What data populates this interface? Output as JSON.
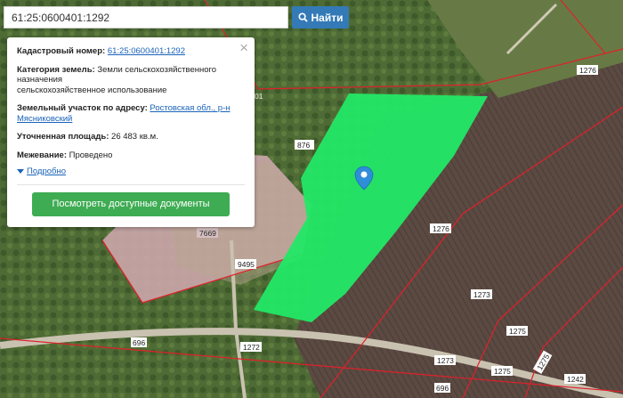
{
  "search": {
    "value": "61:25:0600401:1292",
    "button_label": "Найти"
  },
  "card": {
    "cadastral_label": "Кадастровый номер:",
    "cadastral_value": "61:25:0600401:1292",
    "category_label": "Категория земель:",
    "category_value": "Земли сельскохозяйственного назначения",
    "category_value2": "сельскохозяйственное использование",
    "address_label": "Земельный участок по адресу:",
    "address_value": "Ростовская обл., р-н Мясниковский",
    "area_label": "Уточненная площадь:",
    "area_value": "26 483 кв.м.",
    "survey_label": "Межевание:",
    "survey_value": "Проведено",
    "more_label": "Подробно",
    "docs_button": "Посмотреть доступные документы",
    "close_symbol": "×"
  },
  "map": {
    "parcel_labels": [
      "876",
      "1276",
      "1276",
      "7669",
      "9495",
      "1273",
      "1275",
      "1275",
      "696",
      "1272",
      "1273",
      "1275",
      "1242",
      "696",
      "01"
    ],
    "highlight_color": "#22e866",
    "pin_color": "#2e8ed8"
  }
}
